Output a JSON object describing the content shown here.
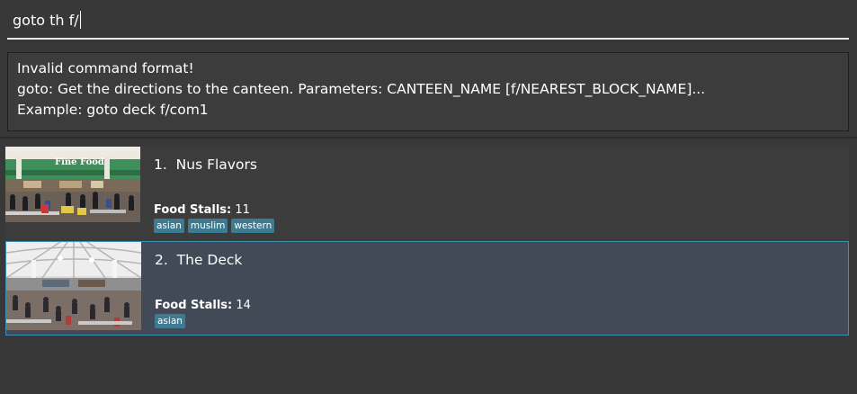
{
  "command": {
    "value": "goto th f/"
  },
  "result": {
    "lines": [
      "Invalid command format!",
      "goto: Get the directions to the canteen. Parameters: CANTEEN_NAME [f/NEAREST_BLOCK_NAME]...",
      "Example: goto deck f/com1"
    ]
  },
  "canteens": [
    {
      "index": "1.",
      "name": "Nus Flavors",
      "stalls_label": "Food Stalls:",
      "stalls": "11",
      "tags": [
        "asian",
        "muslim",
        "western"
      ],
      "image_sign": "Fine Food",
      "selected": false
    },
    {
      "index": "2.",
      "name": "The Deck",
      "stalls_label": "Food Stalls:",
      "stalls": "14",
      "tags": [
        "asian"
      ],
      "selected": true
    }
  ],
  "colors": {
    "background": "#383838",
    "card": "#3c3c3c",
    "selected_card": "#424a57",
    "selected_border": "#3d8fb3",
    "tag": "#3e7b91"
  }
}
